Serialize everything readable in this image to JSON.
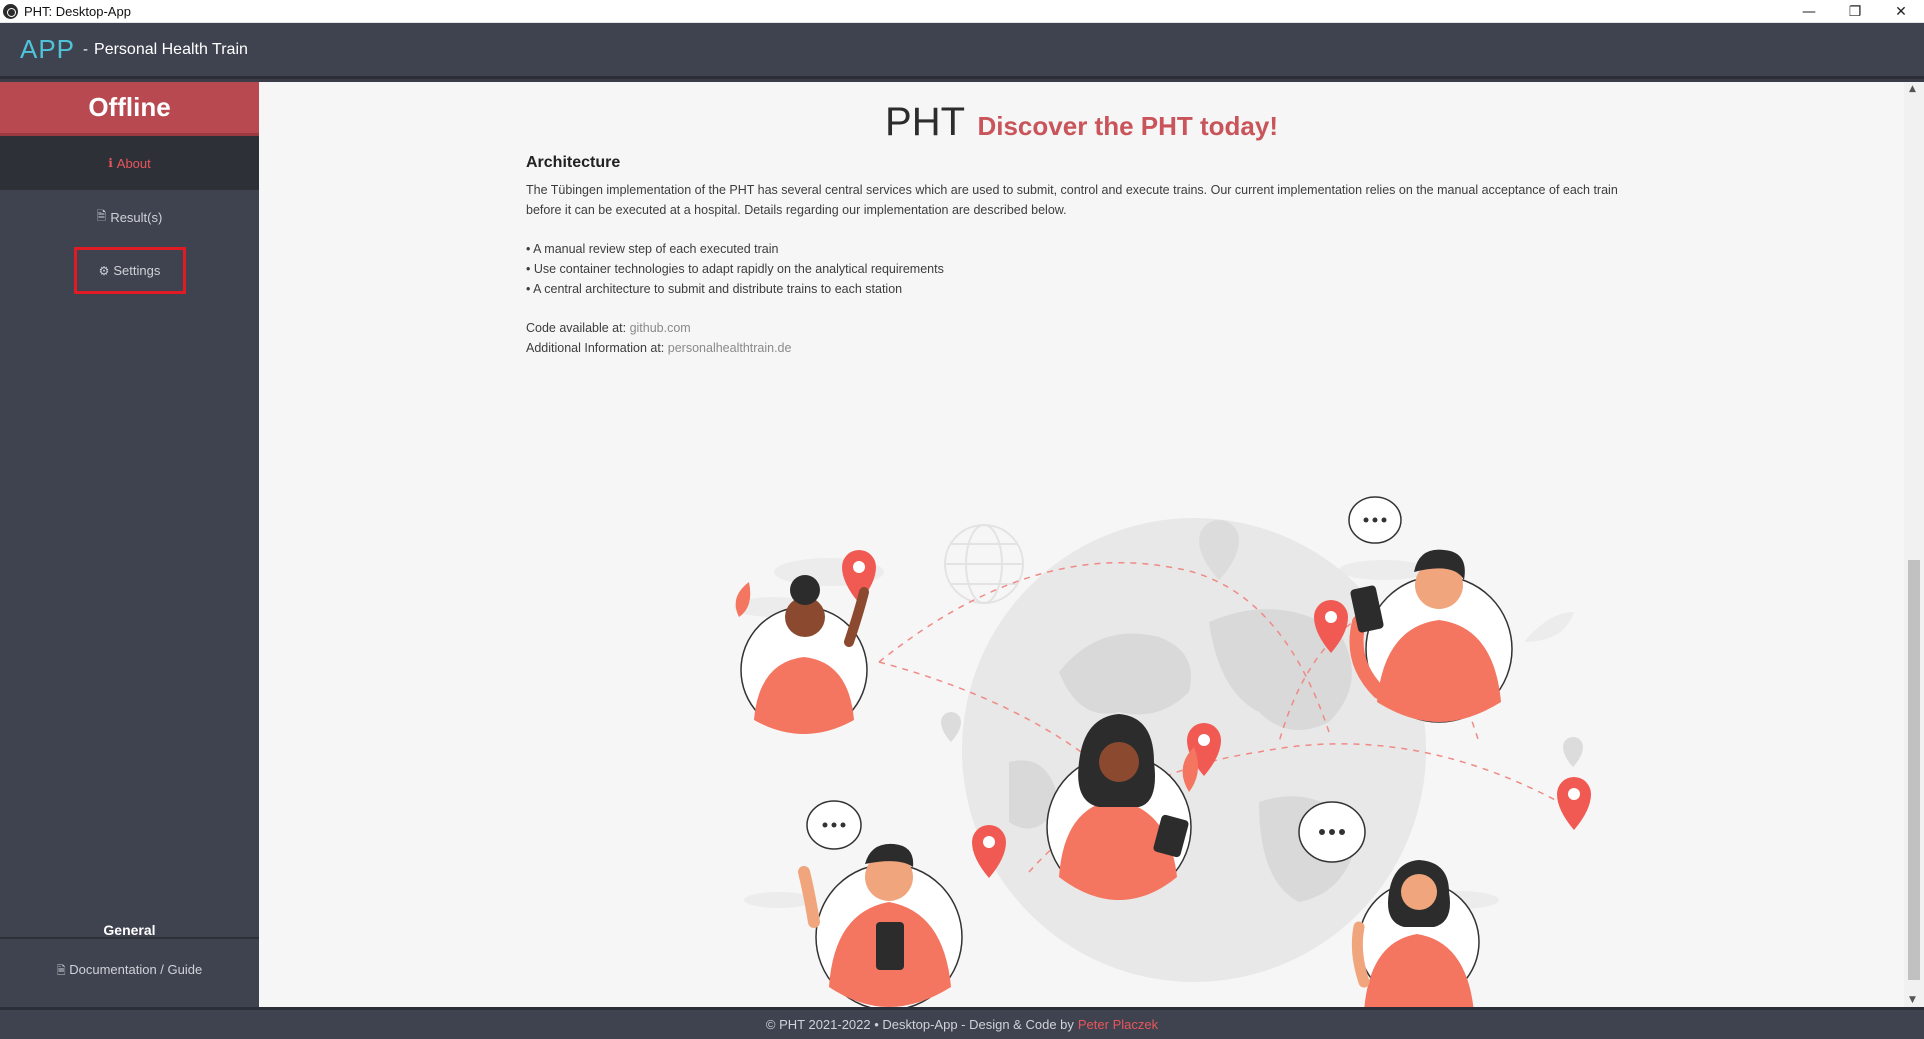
{
  "window": {
    "title": "PHT: Desktop-App",
    "controls": [
      "minimize",
      "restore",
      "close"
    ]
  },
  "header": {
    "brand_short": "APP",
    "brand_separator": "-",
    "brand_name": "Personal Health Train"
  },
  "sidebar": {
    "status": "Offline",
    "items": [
      {
        "label": "About",
        "icon": "info-icon",
        "active": true
      },
      {
        "label": "Result(s)",
        "icon": "file-icon",
        "active": false
      },
      {
        "label": "Settings",
        "icon": "gear-icon",
        "active": false
      }
    ],
    "section_title": "General",
    "doc_link": "Documentation / Guide"
  },
  "main": {
    "title": "PHT",
    "tagline": "Discover the PHT today!",
    "section_heading": "Architecture",
    "description": "The Tübingen implementation of the PHT has several central services which are used to submit, control and execute trains. Our current implementation relies on the manual acceptance of each train before it can be executed at a hospital. Details regarding our implementation are described below.",
    "bullets": [
      "• A manual review step of each executed train",
      "• Use container technologies to adapt rapidly on the analytical requirements",
      "• A central architecture to submit and distribute trains to each station"
    ],
    "code_label": "Code available at:",
    "code_link": "github.com",
    "info_label": "Additional Information at:",
    "info_link": "personalhealthtrain.de"
  },
  "footer": {
    "text": "© PHT 2021-2022 • Desktop-App - Design & Code by",
    "author": "Peter Placzek"
  },
  "colors": {
    "accent": "#e8555a",
    "banner": "#b84951",
    "sidebar": "#3f4350",
    "brand": "#4fc3d9",
    "illustration": "#f47560"
  }
}
